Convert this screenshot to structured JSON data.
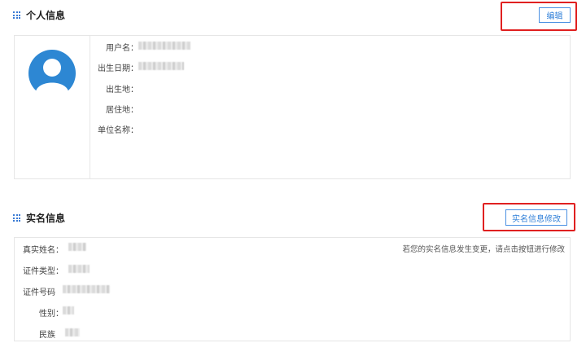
{
  "personal": {
    "title": "个人信息",
    "edit_label": "编辑",
    "fields": [
      {
        "label": "用户名："
      },
      {
        "label": "出生日期："
      },
      {
        "label": "出生地："
      },
      {
        "label": "居住地："
      },
      {
        "label": "单位名称："
      }
    ]
  },
  "realname": {
    "title": "实名信息",
    "modify_label": "实名信息修改",
    "hint": "若您的实名信息发生变更，请点击按钮进行修改",
    "fields": [
      {
        "label": "真实姓名："
      },
      {
        "label": "证件类型："
      },
      {
        "label": "证件号码"
      },
      {
        "label": "性别："
      },
      {
        "label": "民族"
      }
    ]
  },
  "colors": {
    "accent": "#2f7fd8",
    "highlight_border": "#e02020",
    "avatar": "#2d87d3"
  }
}
